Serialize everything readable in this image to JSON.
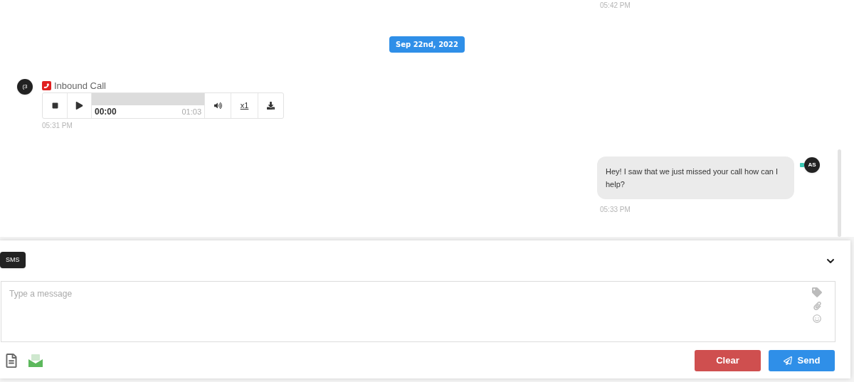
{
  "messages": [
    {
      "kind": "cutoff",
      "time": "05:42 PM"
    },
    {
      "kind": "date",
      "label": "Sep 22nd, 2022"
    },
    {
      "kind": "call",
      "avatar": "(3",
      "title": "Inbound Call",
      "player": {
        "elapsed": "00:00",
        "duration": "01:03",
        "speed": "x1"
      },
      "time": "05:31 PM"
    },
    {
      "kind": "outgoing",
      "avatar": "AS",
      "text": "Hey! I saw that we just missed your call how can I help?",
      "time": "05:33 PM"
    }
  ],
  "composer": {
    "channel": "SMS",
    "expanded": true,
    "placeholder": "Type a message",
    "buttons": [
      {
        "kind": "clear",
        "label": "Clear"
      },
      {
        "kind": "send",
        "label": "Send"
      }
    ]
  }
}
